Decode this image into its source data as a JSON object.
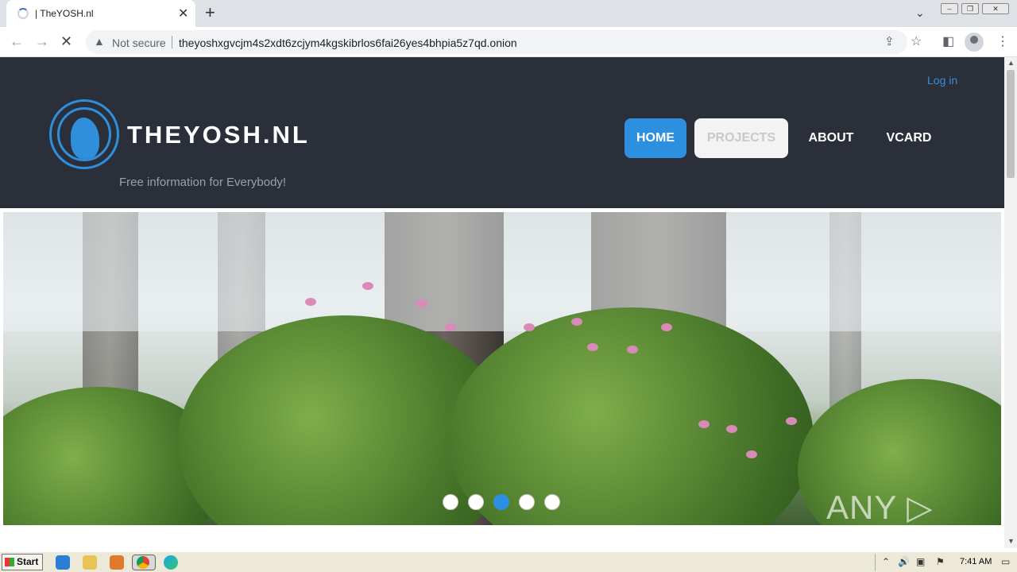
{
  "browser": {
    "tab_title": "| TheYOSH.nl",
    "tab_close": "✕",
    "new_tab": "+",
    "tab_search": "⌄",
    "security_label": "Not secure",
    "url": "theyoshxgvcjm4s2xdt6zcjym4kgskibrlos6fai26yes4bhpia5z7qd.onion"
  },
  "site": {
    "login_label": "Log in",
    "title": "THEYOSH.NL",
    "tagline": "Free information for Everybody!",
    "nav": [
      "HOME",
      "PROJECTS",
      "ABOUT",
      "VCARD"
    ],
    "active_nav": "HOME",
    "slider": {
      "dots": 5,
      "active_dot": 3
    }
  },
  "watermark": "ANY ▷ RUN",
  "taskbar": {
    "start_label": "Start",
    "clock": "7:41 AM"
  },
  "colors": {
    "header_bg": "#2b2f3a",
    "accent": "#2d8fe0",
    "link": "#3a8ed8"
  }
}
